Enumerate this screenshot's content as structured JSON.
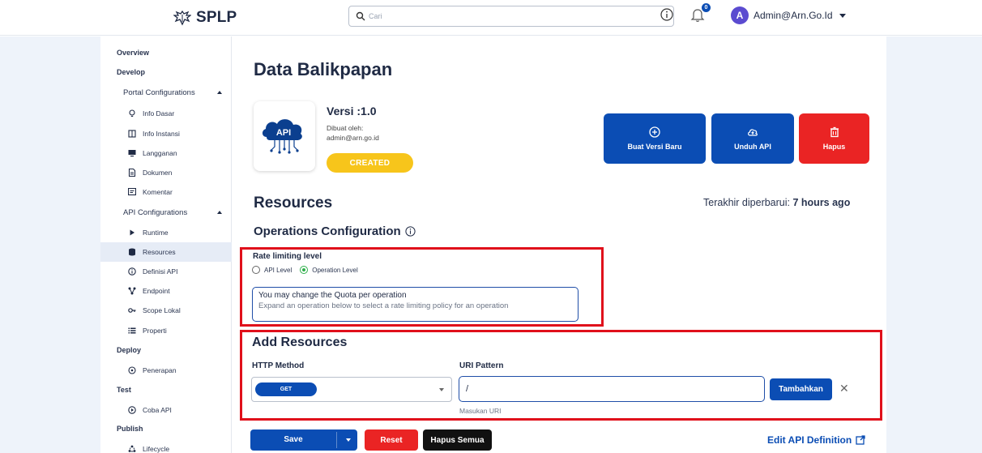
{
  "header": {
    "logo_text": "SPLP",
    "search_placeholder": "Cari",
    "notification_count": "0",
    "user_initial": "A",
    "user_name": "Admin@Arn.Go.Id"
  },
  "sidebar": {
    "overview": "Overview",
    "develop": "Develop",
    "portal_configurations": "Portal Configurations",
    "portal_items": [
      "Info Dasar",
      "Info Instansi",
      "Langganan",
      "Dokumen",
      "Komentar"
    ],
    "api_configurations": "API Configurations",
    "api_items": [
      "Runtime",
      "Resources",
      "Definisi API",
      "Endpoint",
      "Scope Lokal",
      "Properti"
    ],
    "deploy": "Deploy",
    "deploy_items": [
      "Penerapan"
    ],
    "test": "Test",
    "test_items": [
      "Coba API"
    ],
    "publish": "Publish",
    "publish_items": [
      "Lifecycle"
    ],
    "active_item": "Resources"
  },
  "main": {
    "title": "Data Balikpapan",
    "api_logo_text": "API",
    "version": "Versi :1.0",
    "created_by_label": "Dibuat oleh:",
    "created_by": "admin@arn.go.id",
    "status": "CREATED",
    "actions": {
      "new_version": "Buat Versi Baru",
      "download": "Unduh API",
      "delete": "Hapus"
    },
    "resources_title": "Resources",
    "updated_label": "Terakhir diperbarui:",
    "updated_value": "7 hours ago",
    "operations_title": "Operations Configuration",
    "rate_limit": {
      "label": "Rate limiting level",
      "options": [
        "API Level",
        "Operation Level"
      ],
      "selected": "Operation Level",
      "info_line1": "You may change the Quota per operation",
      "info_line2": "Expand an operation below to select a rate limiting policy for an operation"
    },
    "add_resources": {
      "title": "Add Resources",
      "http_method_label": "HTTP Method",
      "http_method_value": "GET",
      "uri_label": "URI Pattern",
      "uri_value": "/",
      "uri_helper": "Masukan URI",
      "add_button": "Tambahkan",
      "clear": "✕"
    },
    "footer": {
      "save": "Save",
      "reset": "Reset",
      "delete_all": "Hapus Semua",
      "edit_definition": "Edit API Definition"
    }
  },
  "colors": {
    "primary": "#0b4db4",
    "danger": "#ea2424",
    "warning": "#f7c51b",
    "highlight": "#e0101b"
  }
}
